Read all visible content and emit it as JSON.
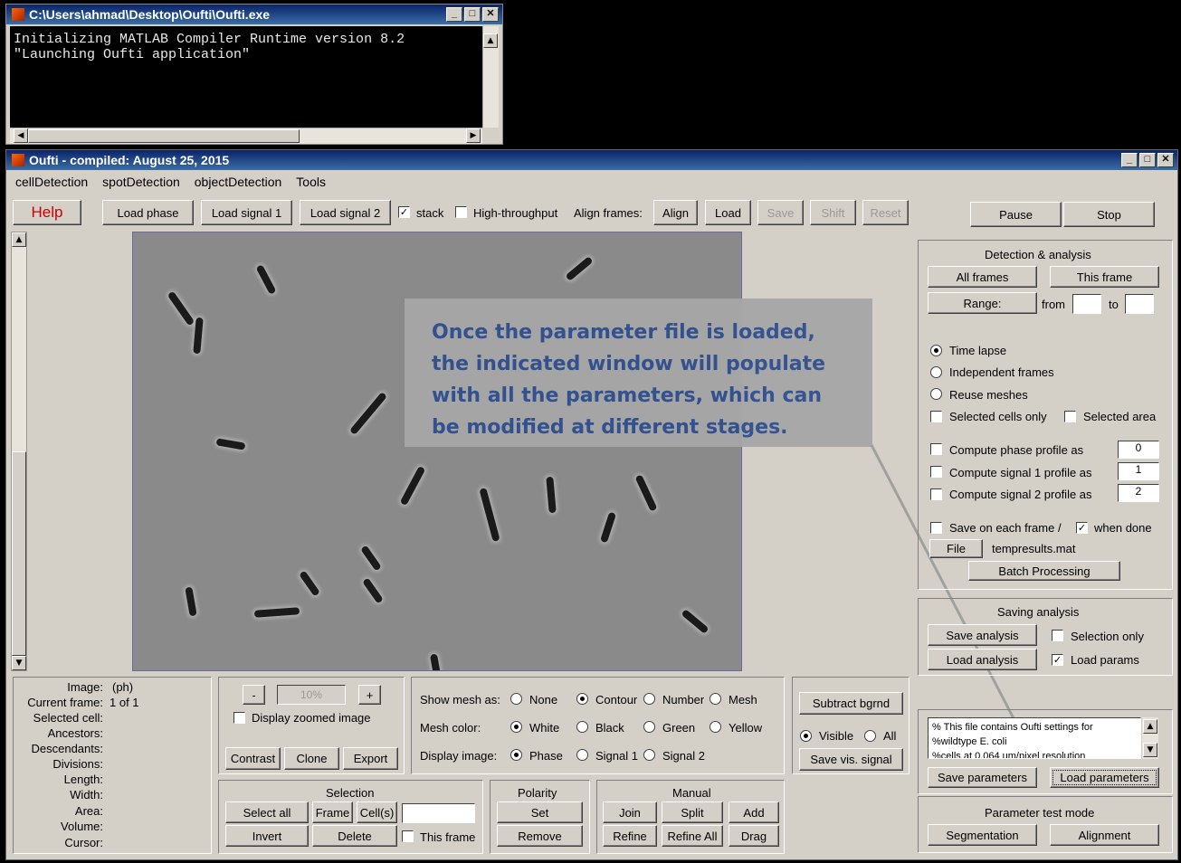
{
  "console": {
    "title": "C:\\Users\\ahmad\\Desktop\\Oufti\\Oufti.exe",
    "line1": "Initializing MATLAB Compiler Runtime version 8.2",
    "line2": "\"Launching Oufti application\""
  },
  "main": {
    "title": "Oufti - compiled:  August 25, 2015",
    "menu": [
      "cellDetection",
      "spotDetection",
      "objectDetection",
      "Tools"
    ]
  },
  "toolbar": {
    "help": "Help",
    "load_phase": "Load phase",
    "load_signal1": "Load signal 1",
    "load_signal2": "Load signal 2",
    "stack": "stack",
    "high_throughput": "High-throughput",
    "align_frames": "Align frames:",
    "align": "Align",
    "load": "Load",
    "save": "Save",
    "shift": "Shift",
    "reset": "Reset",
    "pause": "Pause",
    "stop": "Stop"
  },
  "detection": {
    "title": "Detection & analysis",
    "all_frames": "All frames",
    "this_frame": "This frame",
    "range": "Range:",
    "from": "from",
    "to": "to",
    "time_lapse": "Time lapse",
    "independent_frames": "Independent frames",
    "reuse_meshes": "Reuse meshes",
    "selected_cells_only": "Selected cells only",
    "selected_area": "Selected area",
    "compute_phase": "Compute phase profile as",
    "compute_signal1": "Compute signal 1 profile as",
    "compute_signal2": "Compute signal 2 profile as",
    "phase_val": "0",
    "signal1_val": "1",
    "signal2_val": "2",
    "save_each_frame": "Save on each frame /",
    "when_done": "when done",
    "file": "File",
    "filename": "tempresults.mat",
    "batch": "Batch Processing"
  },
  "saving": {
    "title": "Saving analysis",
    "save_analysis": "Save analysis",
    "load_analysis": "Load analysis",
    "selection_only": "Selection only",
    "load_params": "Load params"
  },
  "params": {
    "line1": "% This file contains Oufti settings for",
    "line2": "%wildtype E. coli",
    "line3": "%cells at 0.064 um/pixel resolution",
    "save_parameters": "Save parameters",
    "load_parameters": "Load parameters"
  },
  "test_mode": {
    "title": "Parameter test mode",
    "segmentation": "Segmentation",
    "alignment": "Alignment"
  },
  "info": {
    "image_label": "Image:",
    "image_val": "(ph)",
    "current_frame_label": "Current frame:",
    "current_frame_val": "1 of 1",
    "selected_cell": "Selected cell:",
    "ancestors": "Ancestors:",
    "descendants": "Descendants:",
    "divisions": "Divisions:",
    "length": "Length:",
    "width": "Width:",
    "area": "Area:",
    "volume": "Volume:",
    "cursor": "Cursor:"
  },
  "zoom": {
    "minus": "-",
    "value": "10%",
    "plus": "+",
    "display_zoomed": "Display zoomed image",
    "contrast": "Contrast",
    "clone": "Clone",
    "export": "Export"
  },
  "display": {
    "show_mesh_as": "Show mesh as:",
    "none": "None",
    "contour": "Contour",
    "number": "Number",
    "mesh": "Mesh",
    "mesh_color": "Mesh color:",
    "white": "White",
    "black": "Black",
    "green": "Green",
    "yellow": "Yellow",
    "display_image": "Display image:",
    "phase": "Phase",
    "signal1": "Signal 1",
    "signal2": "Signal 2"
  },
  "background": {
    "subtract": "Subtract bgrnd",
    "visible": "Visible",
    "all": "All",
    "save_vis": "Save vis. signal"
  },
  "selection": {
    "title": "Selection",
    "select_all": "Select all",
    "frame": "Frame",
    "cells": "Cell(s)",
    "invert": "Invert",
    "delete": "Delete",
    "this_frame": "This frame"
  },
  "polarity": {
    "title": "Polarity",
    "set": "Set",
    "remove": "Remove"
  },
  "manual": {
    "title": "Manual",
    "join": "Join",
    "split": "Split",
    "add": "Add",
    "refine": "Refine",
    "refine_all": "Refine All",
    "drag": "Drag"
  },
  "callout": {
    "text": "Once the parameter file is loaded, the indicated window will populate with all the parameters, which can be modified at different stages."
  },
  "colors": {
    "title_bar": "#0a246a",
    "window_bg": "#d4d0c8",
    "callout_bg": "#a7a7a7",
    "callout_text": "#2f4f8f",
    "help_text": "#cc0000"
  }
}
